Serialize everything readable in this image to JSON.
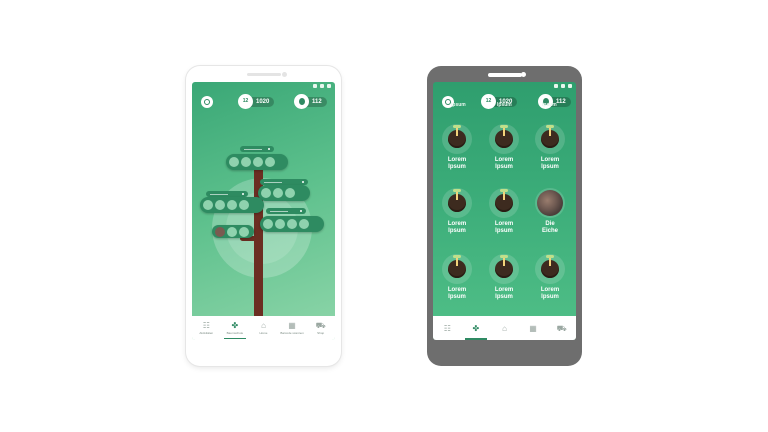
{
  "left_phone": {
    "stats": {
      "calendar_day": "12",
      "calendar_count": "1020",
      "seed_count": "112"
    },
    "nav": [
      {
        "label": "Aktivitäten",
        "icon": "activity-icon",
        "glyph": "☷",
        "active": false
      },
      {
        "label": "Baumschule",
        "icon": "clover-icon",
        "glyph": "✤",
        "active": true
      },
      {
        "label": "Home",
        "icon": "home-icon",
        "glyph": "⌂",
        "active": false
      },
      {
        "label": "Barcode scannen",
        "icon": "barcode-icon",
        "glyph": "▦",
        "active": false
      },
      {
        "label": "Shop",
        "icon": "cart-icon",
        "glyph": "⛟",
        "active": false
      }
    ]
  },
  "right_phone": {
    "stats": {
      "calendar_day": "12",
      "calendar_count": "1020",
      "seed_count": "112"
    },
    "top_partial": [
      "Ipsum",
      "Ipsum",
      "Ipsum"
    ],
    "seeds": [
      {
        "line1": "Lorem",
        "line2": "Ipsum",
        "kind": "sprout"
      },
      {
        "line1": "Lorem",
        "line2": "Ipsum",
        "kind": "sprout"
      },
      {
        "line1": "Lorem",
        "line2": "Ipsum",
        "kind": "sprout"
      },
      {
        "line1": "Lorem",
        "line2": "Ipsum",
        "kind": "sprout"
      },
      {
        "line1": "Lorem",
        "line2": "Ipsum",
        "kind": "sprout"
      },
      {
        "line1": "Die",
        "line2": "Eiche",
        "kind": "photo"
      },
      {
        "line1": "Lorem",
        "line2": "Ipsum",
        "kind": "sprout"
      },
      {
        "line1": "Lorem",
        "line2": "Ipsum",
        "kind": "sprout"
      },
      {
        "line1": "Lorem",
        "line2": "Ipsum",
        "kind": "sprout"
      }
    ],
    "nav": [
      {
        "icon": "activity-icon",
        "glyph": "☷",
        "active": false
      },
      {
        "icon": "clover-icon",
        "glyph": "✤",
        "active": true
      },
      {
        "icon": "home-icon",
        "glyph": "⌂",
        "active": false
      },
      {
        "icon": "barcode-icon",
        "glyph": "▦",
        "active": false
      },
      {
        "icon": "cart-icon",
        "glyph": "⛟",
        "active": false
      }
    ]
  },
  "colors": {
    "accent": "#2f8a63",
    "trunk": "#6b2e22",
    "soil": "#3d2b1f"
  }
}
